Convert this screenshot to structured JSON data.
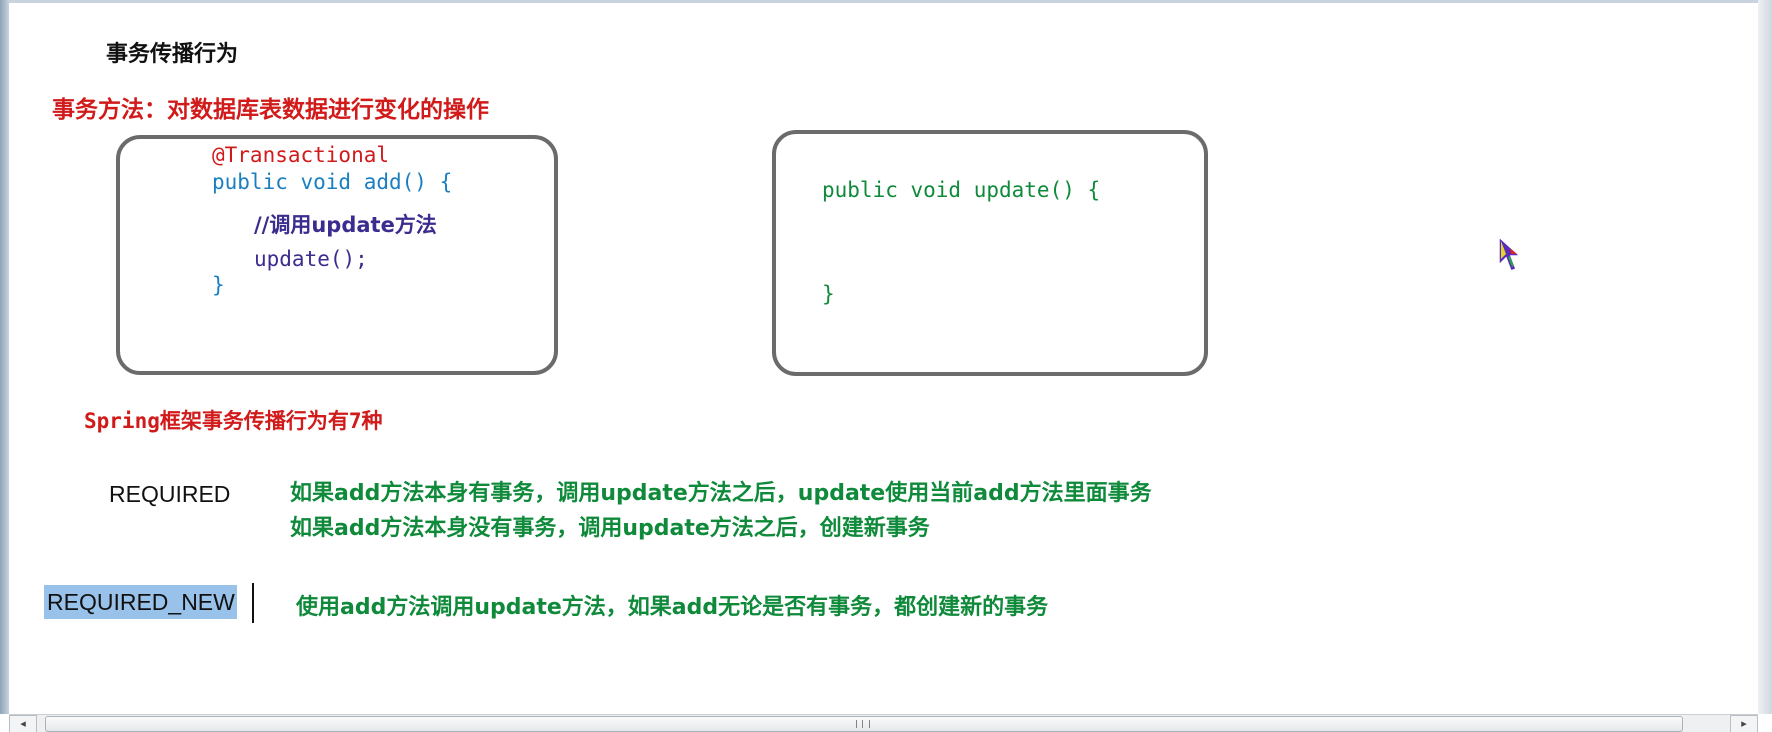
{
  "slide": {
    "title": "事务传播行为",
    "subtitle": "事务方法：对数据库表数据进行变化的操作"
  },
  "code_left": {
    "annotation": "@Transactional",
    "signature": "public void add() {",
    "comment": "//调用update方法",
    "call": "update();",
    "close": "}"
  },
  "code_right": {
    "signature": "public void update() {",
    "close": "}"
  },
  "section": {
    "heading": "Spring框架事务传播行为有7种"
  },
  "propagation": [
    {
      "name": "REQUIRED",
      "lines": [
        "如果add方法本身有事务，调用update方法之后，update使用当前add方法里面事务",
        "如果add方法本身没有事务，调用update方法之后，创建新事务"
      ]
    },
    {
      "name": "REQUIRED_NEW",
      "lines": [
        "使用add方法调用update方法，如果add无论是否有事务，都创建新的事务"
      ]
    }
  ],
  "scrollbar": {
    "left_arrow": "◂",
    "right_arrow": "▸"
  },
  "icons": {
    "cursor": "mouse-pointer-icon"
  },
  "colors": {
    "red_text": "#d11a1a",
    "green_text": "#0f8a3a",
    "blue_code": "#1a7fc0",
    "selection": "#99c2ea",
    "box_border": "#6b6b6b"
  }
}
